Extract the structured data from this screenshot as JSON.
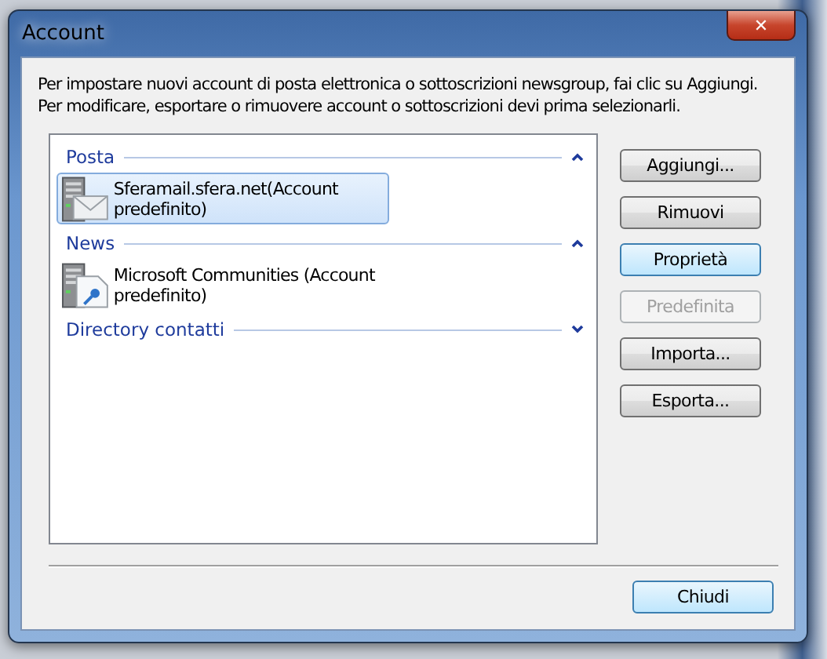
{
  "window": {
    "title": "Account",
    "close_glyph": "✕"
  },
  "instructions": [
    "Per impostare nuovi account di posta elettronica o sottoscrizioni newsgroup, fai clic su Aggiungi.",
    "Per modificare, esportare o rimuovere account o sottoscrizioni devi prima selezionarli."
  ],
  "groups": [
    {
      "label": "Posta",
      "expanded": true,
      "items": [
        {
          "kind": "mail",
          "name": "Sferamail.sfera.net(Account predefinito)",
          "selected": true
        }
      ]
    },
    {
      "label": "News",
      "expanded": true,
      "items": [
        {
          "kind": "news",
          "name": "Microsoft Communities (Account predefinito)",
          "selected": false
        }
      ]
    },
    {
      "label": "Directory contatti",
      "expanded": false
    }
  ],
  "buttons": [
    {
      "label": "Aggiungi...",
      "disabled": false,
      "focused": false
    },
    {
      "label": "Rimuovi",
      "disabled": false,
      "focused": false
    },
    {
      "label": "Proprietà",
      "disabled": false,
      "focused": true
    },
    {
      "label": "Predefinita",
      "disabled": true,
      "focused": false
    },
    {
      "label": "Importa...",
      "disabled": false,
      "focused": false
    },
    {
      "label": "Esporta...",
      "disabled": false,
      "focused": false
    }
  ],
  "close_button": {
    "label": "Chiudi"
  }
}
